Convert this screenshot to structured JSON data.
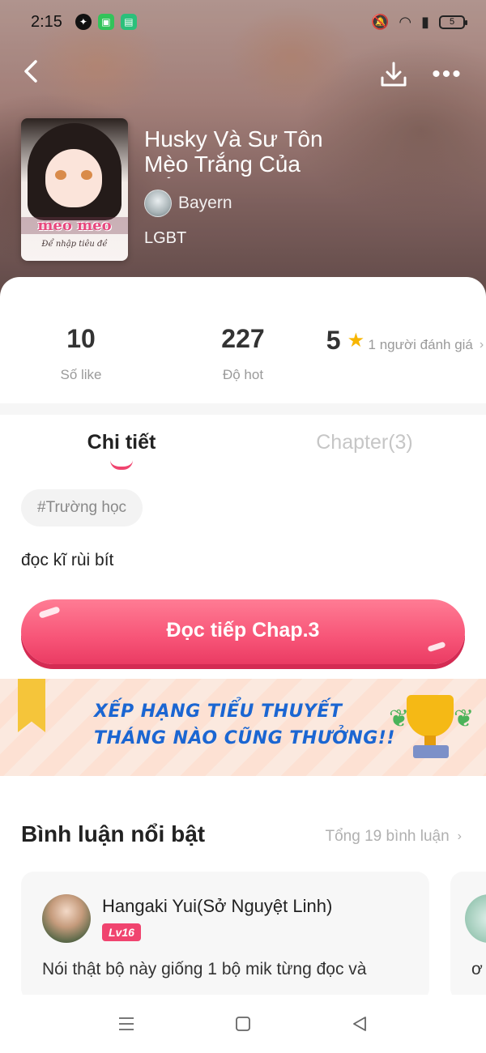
{
  "status_bar": {
    "time": "2:15",
    "battery": "5"
  },
  "book": {
    "title": "Husky Và Sư Tôn Mèo Trắng Của Hắn",
    "author": "Bayern",
    "genre": "LGBT",
    "cover": {
      "title": "meo meo",
      "subtitle": "Để nhập tiêu đề"
    }
  },
  "stats": {
    "likes": {
      "value": "10",
      "label": "Số like"
    },
    "hot": {
      "value": "227",
      "label": "Độ hot"
    },
    "rating": {
      "value": "5",
      "label": "1 người đánh giá"
    }
  },
  "tabs": [
    {
      "label": "Chi tiết",
      "active": true
    },
    {
      "label": "Chapter(3)",
      "active": false
    }
  ],
  "detail": {
    "tag": "#Trường học",
    "description": "đọc kĩ rùi bít",
    "read_button": "Đọc tiếp Chap.3"
  },
  "banner": {
    "line1": "XẾP HẠNG TIỂU THUYẾT",
    "line2": "THÁNG NÀO CŨNG THƯỞNG!!"
  },
  "comments": {
    "title": "Bình luận nổi bật",
    "total": "Tổng 19 bình luận",
    "items": [
      {
        "user": "Hangaki Yui(Sở Nguyệt Linh)",
        "level": "Lv16",
        "text": "Nói thật bộ này giống 1 bộ mik từng đọc và"
      }
    ],
    "peek_text": "ơ"
  },
  "icons": {
    "back": "back-arrow-icon",
    "download": "download-icon",
    "more": "more-dots-icon",
    "star": "star-icon",
    "chevron": "chevron-right-icon"
  },
  "colors": {
    "accent": "#f0446f",
    "star": "#f7b500",
    "banner_text": "#1b66d2"
  }
}
